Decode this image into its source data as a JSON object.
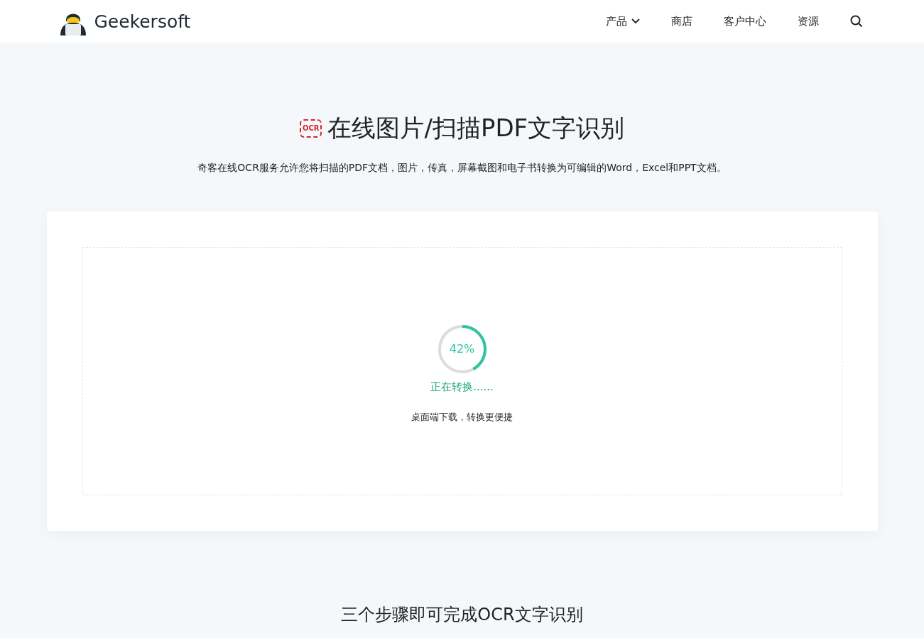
{
  "header": {
    "brand": "Geekersoft",
    "nav": [
      {
        "label": "产品",
        "dropdown": true
      },
      {
        "label": "商店",
        "dropdown": false
      },
      {
        "label": "客户中心",
        "dropdown": false
      },
      {
        "label": "资源",
        "dropdown": false
      }
    ]
  },
  "hero": {
    "icon_text": "OCR",
    "title": "在线图片/扫描PDF文字识别",
    "subtitle": "奇客在线OCR服务允许您将扫描的PDF文档，图片，传真，屏幕截图和电子书转换为可编辑的Word，Excel和PPT文档。"
  },
  "converter": {
    "progress": {
      "level": 0.42,
      "reading": "42%"
    },
    "status": "正在转换......",
    "download_link": "桌面端下载，转换更便捷"
  },
  "steps": {
    "heading": "三个步骤即可完成OCR文字识别"
  }
}
